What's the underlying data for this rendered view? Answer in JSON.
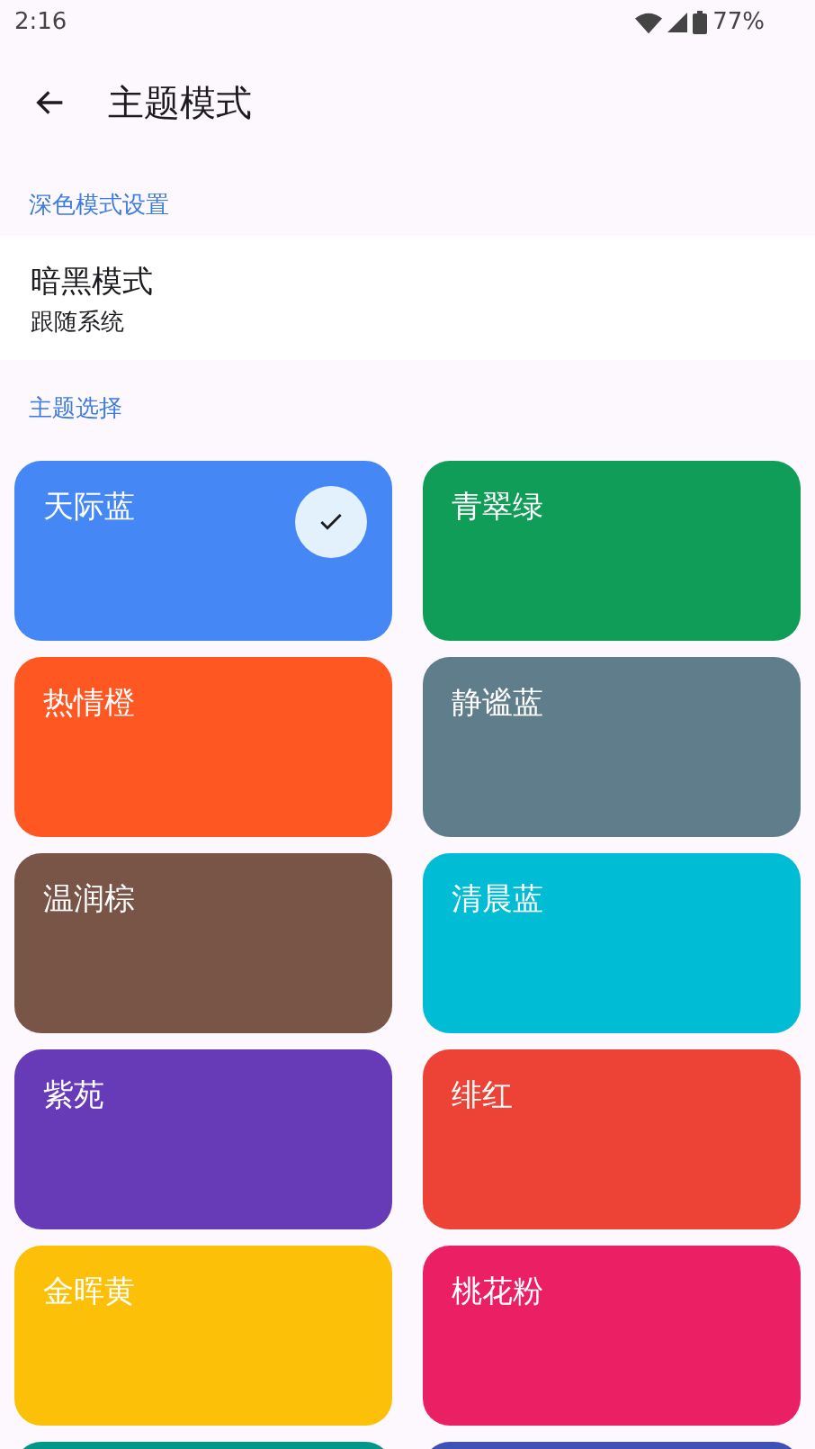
{
  "status_bar": {
    "time": "2:16",
    "battery": "77%"
  },
  "app_bar": {
    "title": "主题模式"
  },
  "sections": [
    {
      "label": "深色模式设置"
    }
  ],
  "dark_mode": {
    "title": "暗黑模式",
    "subtitle": "跟随系统"
  },
  "theme_section": {
    "label": "主题选择"
  },
  "themes": [
    {
      "name": "天际蓝",
      "color": "#4487f5",
      "selected": true
    },
    {
      "name": "青翠绿",
      "color": "#109d58",
      "selected": false
    },
    {
      "name": "热情橙",
      "color": "#ff5722",
      "selected": false
    },
    {
      "name": "静谧蓝",
      "color": "#607d8b",
      "selected": false
    },
    {
      "name": "温润棕",
      "color": "#795548",
      "selected": false
    },
    {
      "name": "清晨蓝",
      "color": "#00bcd4",
      "selected": false
    },
    {
      "name": "紫苑",
      "color": "#673ab7",
      "selected": false
    },
    {
      "name": "绯红",
      "color": "#ed4337",
      "selected": false
    },
    {
      "name": "金晖黄",
      "color": "#fbc007",
      "selected": false
    },
    {
      "name": "桃花粉",
      "color": "#eb1f64",
      "selected": false
    },
    {
      "color": "#009688"
    },
    {
      "color": "#3f51b5"
    }
  ]
}
